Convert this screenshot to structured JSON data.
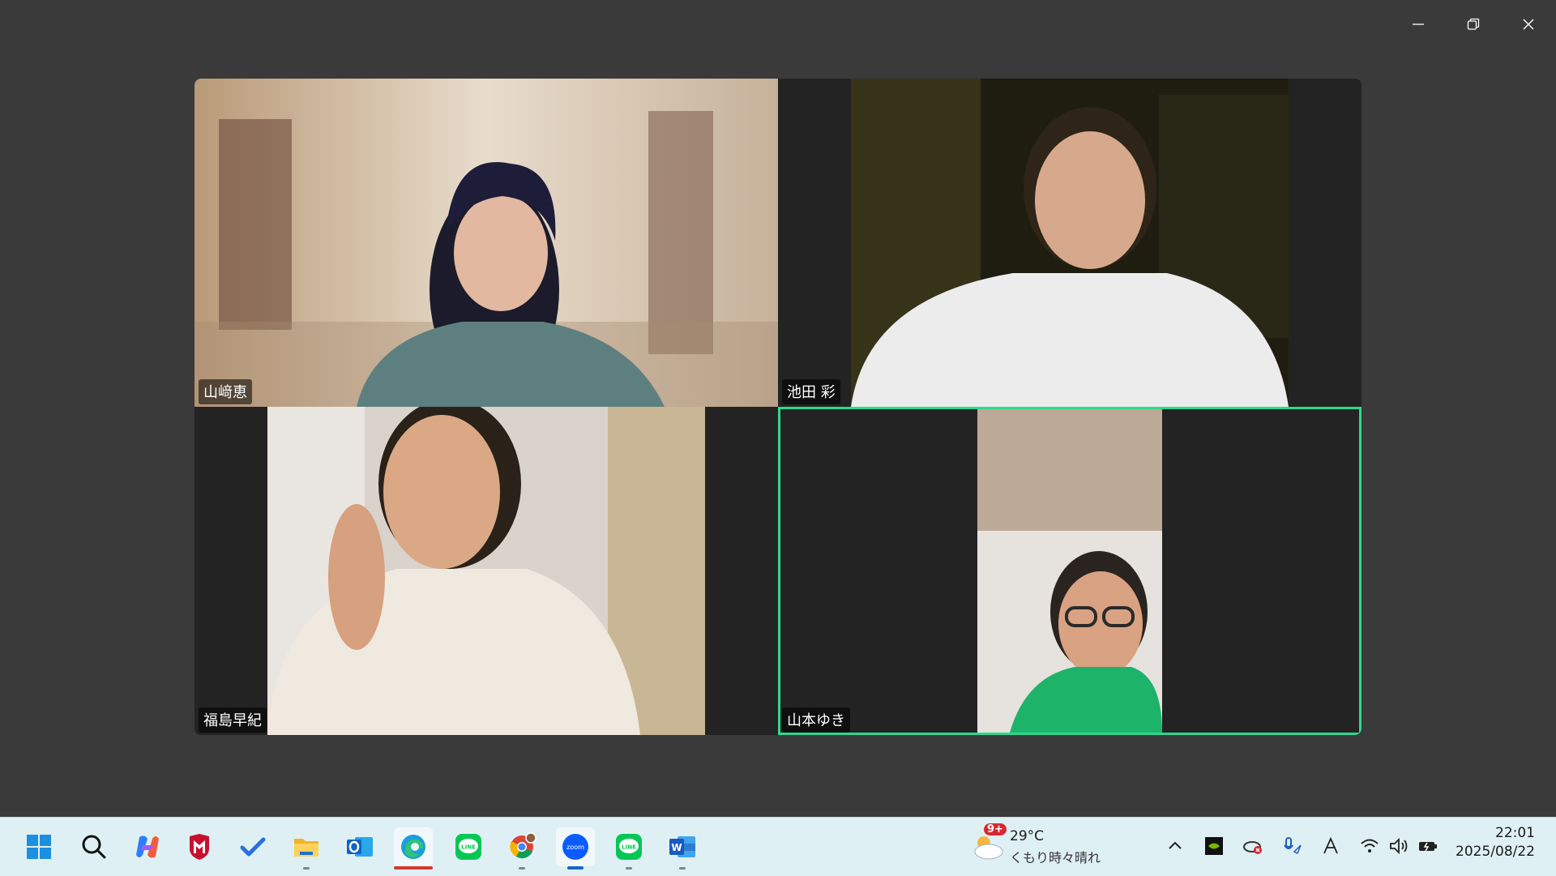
{
  "participants": [
    {
      "name": "山﨑恵",
      "active": false
    },
    {
      "name": "池田 彩",
      "active": false
    },
    {
      "name": "福島早紀",
      "active": false
    },
    {
      "name": "山本ゆき",
      "active": true
    }
  ],
  "taskbar": {
    "apps": [
      "windows-start",
      "search",
      "copilot",
      "mcafee",
      "todo",
      "file-explorer",
      "outlook",
      "edge",
      "line",
      "chrome",
      "zoom",
      "line",
      "word"
    ],
    "weather": {
      "temp": "29°C",
      "condition": "くもり時々晴れ",
      "badge": "9+"
    },
    "clock": {
      "time": "22:01",
      "date": "2025/08/22"
    }
  },
  "colors": {
    "active_speaker": "#2dd98b",
    "background": "#3a3a3a",
    "taskbar": "#dff0f5"
  }
}
